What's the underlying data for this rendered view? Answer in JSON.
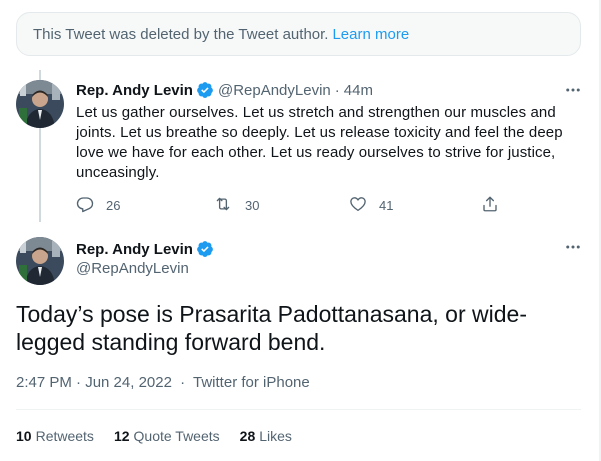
{
  "deleted_notice": {
    "text": "This Tweet was deleted by the Tweet author.",
    "link": "Learn more"
  },
  "reply_tweet": {
    "author_name": "Rep. Andy Levin",
    "handle": "@RepAndyLevin",
    "separator": "·",
    "time": "44m",
    "text": "Let us gather ourselves. Let us stretch and strengthen our muscles and joints. Let us breathe so deeply. Let us release toxicity and feel the deep love we have for each other. Let us ready ourselves to strive for justice, unceasingly.",
    "replies": "26",
    "retweets": "30",
    "likes": "41"
  },
  "main_tweet": {
    "author_name": "Rep. Andy Levin",
    "handle": "@RepAndyLevin",
    "text": "Today’s pose is Prasarita Padottanasana, or wide-legged standing forward bend.",
    "timestamp": "2:47 PM · Jun 24, 2022",
    "separator": "·",
    "source": "Twitter for iPhone"
  },
  "stats": {
    "retweets_count": "10",
    "retweets_label": "Retweets",
    "quotes_count": "12",
    "quotes_label": "Quote Tweets",
    "likes_count": "28",
    "likes_label": "Likes"
  },
  "colors": {
    "accent": "#1d9bf0",
    "secondary_text": "#536471",
    "primary_text": "#0f1419"
  }
}
